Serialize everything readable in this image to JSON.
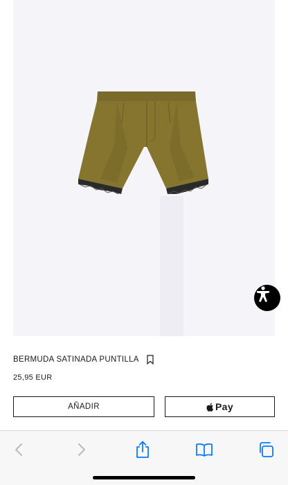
{
  "product": {
    "name": "BERMUDA SATINADA PUNTILLA",
    "price": "25,95 EUR",
    "image_icon": "shorts-image"
  },
  "actions": {
    "add_label": "AÑADIR",
    "pay_label": "Pay",
    "pay_icon": "apple-logo-icon"
  },
  "accessibility": {
    "icon": "accessibility-icon"
  },
  "browser_toolbar": {
    "items": [
      "back-icon",
      "forward-icon",
      "share-icon",
      "bookmarks-icon",
      "tabs-icon"
    ],
    "accent": "#0a7aff",
    "disabled": "#b8b8bd"
  }
}
